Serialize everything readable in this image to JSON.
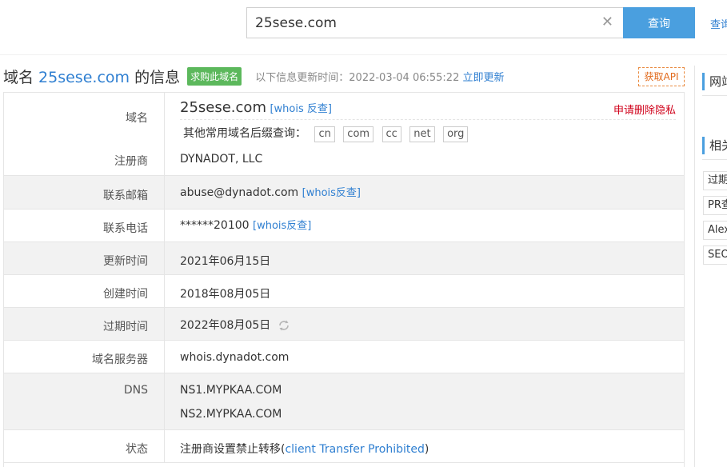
{
  "search": {
    "value": "25sese.com",
    "button_label": "查询",
    "top_link": "查询"
  },
  "header": {
    "title_prefix": "域名 ",
    "domain": "25sese.com",
    "title_suffix": " 的信息",
    "buy_badge": "求购此域名",
    "update_text": "以下信息更新时间：2022-03-04 06:55:22",
    "update_link": "立即更新",
    "api_badge": "获取API"
  },
  "whois": {
    "domain_label": "域名",
    "domain_value": "25sese.com",
    "domain_whois_link": "[whois 反查]",
    "privacy_link": "申请删除隐私",
    "suffix_prompt": "其他常用域名后缀查询：",
    "suffixes": [
      "cn",
      "com",
      "cc",
      "net",
      "org"
    ],
    "registrar_label": "注册商",
    "registrar_value": "DYNADOT, LLC",
    "email_label": "联系邮箱",
    "email_value": "abuse@dynadot.com",
    "email_whois_link": "[whois反查]",
    "phone_label": "联系电话",
    "phone_value": "******20100",
    "phone_whois_link": "[whois反查]",
    "updated_label": "更新时间",
    "updated_value": "2021年06月15日",
    "created_label": "创建时间",
    "created_value": "2018年08月05日",
    "expires_label": "过期时间",
    "expires_value": "2022年08月05日",
    "server_label": "域名服务器",
    "server_value": "whois.dynadot.com",
    "dns_label": "DNS",
    "dns_values": [
      "NS1.MYPKAA.COM",
      "NS2.MYPKAA.COM"
    ],
    "status_label": "状态",
    "status_prefix": "注册商设置禁止转移(",
    "status_link": "client Transfer Prohibited",
    "status_suffix": ")"
  },
  "sidebar": {
    "head1": "网站",
    "head2": "相关",
    "items": [
      "过期",
      "PR查",
      "Alex",
      "SEO"
    ]
  },
  "colors": {
    "accent": "#4a9fdf",
    "link": "#2f7fd1",
    "badge_green": "#5cb85c",
    "privacy_red": "#d0021b",
    "api_orange": "#e16a1c"
  }
}
